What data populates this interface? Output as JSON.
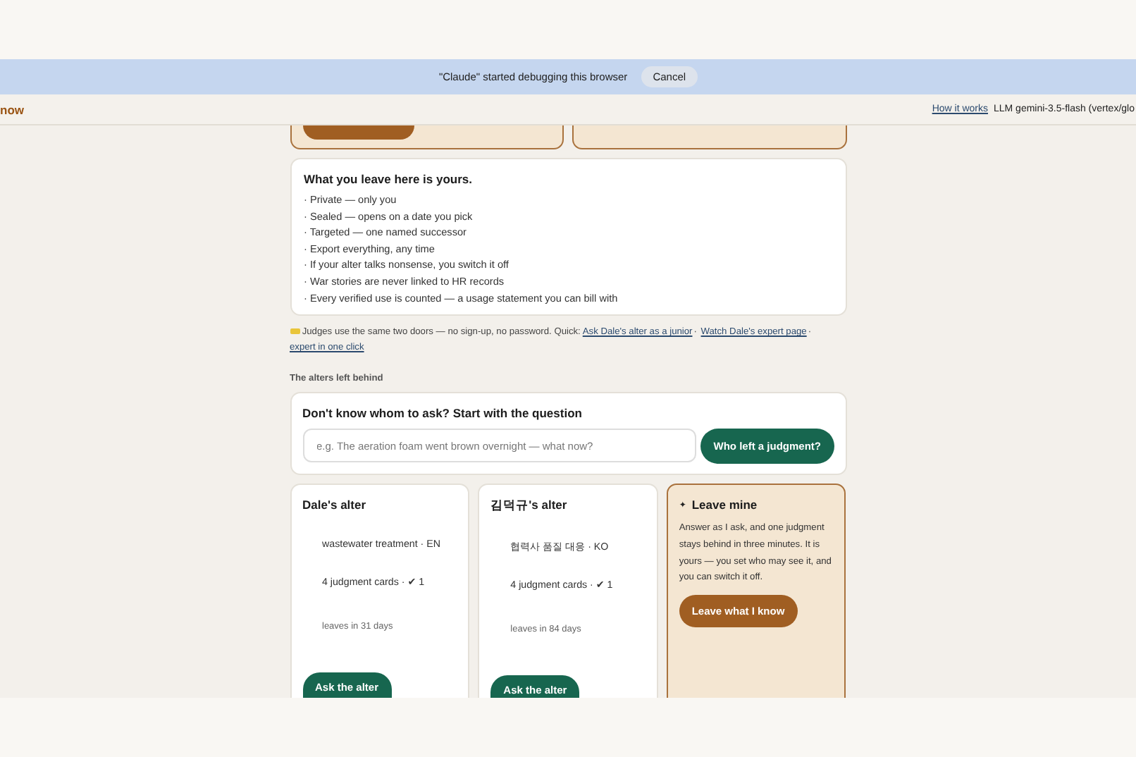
{
  "debug_bar": {
    "message": "\"Claude\" started debugging this browser",
    "cancel": "Cancel"
  },
  "header": {
    "brand": "now",
    "link": "How it works",
    "model": "LLM gemini-3.5-flash (vertex/glo"
  },
  "promises": {
    "title": "What you leave here is yours.",
    "items": [
      "· Private — only you",
      "· Sealed — opens on a date you pick",
      "· Targeted — one named successor",
      "· Export everything, any time",
      "· If your alter talks nonsense, you switch it off",
      "· War stories are never linked to HR records",
      "· Every verified use is counted — a usage statement you can bill with"
    ]
  },
  "judges_note": {
    "separator": "·",
    "text": "Judges use the same two doors — no sign-up, no password. Quick:",
    "links": [
      "Ask Dale's alter as a junior",
      "Watch Dale's expert page",
      "expert in one click"
    ]
  },
  "section_title": "The alters left behind",
  "question": {
    "title": "Don't know whom to ask? Start with the question",
    "placeholder": "e.g. The aeration foam went brown overnight — what now?",
    "button": "Who left a judgment?"
  },
  "alters": [
    {
      "kind": "alter",
      "name": "Dale's alter",
      "field": "wastewater treatment · EN",
      "cards": "4 judgment cards · ✔ 1",
      "leaves": "leaves in 31 days",
      "button": "Ask the alter"
    },
    {
      "kind": "alter",
      "name": "김덕규's alter",
      "field": "협력사 품질 대응 · KO",
      "cards": "4 judgment cards · ✔ 1",
      "leaves": "leaves in 84 days",
      "button": "Ask the alter"
    },
    {
      "kind": "invite",
      "star": "✦",
      "name": "Leave mine",
      "text": "Answer as I ask, and one judgment stays behind in three minutes. It is yours — you set who may see it, and you can switch it off.",
      "button": "Leave what I know"
    }
  ]
}
